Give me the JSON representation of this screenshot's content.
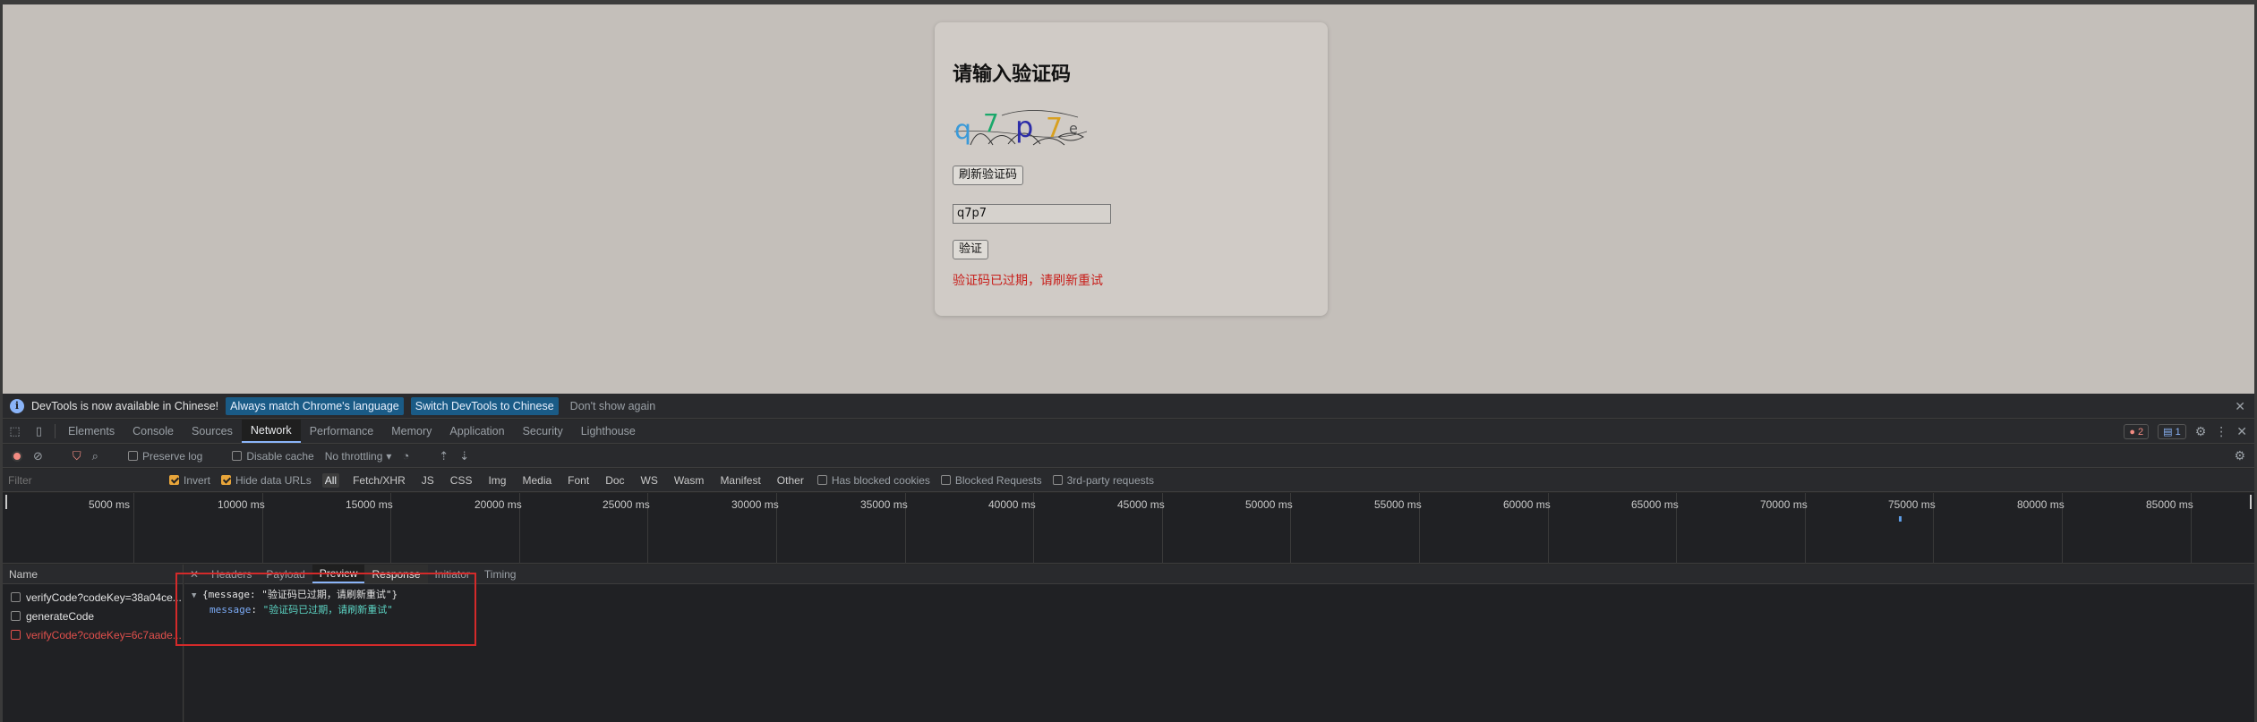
{
  "page": {
    "title": "请输入验证码",
    "refresh_button": "刷新验证码",
    "code_value": "q7p7",
    "verify_button": "验证",
    "error_message": "验证码已过期，请刷新重试",
    "captcha_chars": [
      "q",
      "7",
      "p",
      "7",
      "e"
    ]
  },
  "devtools": {
    "info": {
      "text": "DevTools is now available in Chinese!",
      "btn_match": "Always match Chrome's language",
      "btn_switch": "Switch DevTools to Chinese",
      "dismiss": "Don't show again"
    },
    "tabs": [
      "Elements",
      "Console",
      "Sources",
      "Network",
      "Performance",
      "Memory",
      "Application",
      "Security",
      "Lighthouse"
    ],
    "active_tab": "Network",
    "error_count": "2",
    "info_count": "1",
    "network": {
      "preserve_log": "Preserve log",
      "disable_cache": "Disable cache",
      "throttling": "No throttling"
    },
    "filter": {
      "placeholder": "Filter",
      "invert": "Invert",
      "hide_data_urls": "Hide data URLs",
      "types": [
        "All",
        "Fetch/XHR",
        "JS",
        "CSS",
        "Img",
        "Media",
        "Font",
        "Doc",
        "WS",
        "Wasm",
        "Manifest",
        "Other"
      ],
      "has_blocked_cookies": "Has blocked cookies",
      "blocked_requests": "Blocked Requests",
      "third_party": "3rd-party requests"
    },
    "timeline_ticks": [
      "5000 ms",
      "10000 ms",
      "15000 ms",
      "20000 ms",
      "25000 ms",
      "30000 ms",
      "35000 ms",
      "40000 ms",
      "45000 ms",
      "50000 ms",
      "55000 ms",
      "60000 ms",
      "65000 ms",
      "70000 ms",
      "75000 ms",
      "80000 ms",
      "85000 ms"
    ],
    "requests": {
      "header": "Name",
      "rows": [
        {
          "name": "verifyCode?codeKey=38a04ce..."
        },
        {
          "name": "generateCode"
        },
        {
          "name": "verifyCode?codeKey=6c7aade..."
        }
      ]
    },
    "detail_tabs": [
      "Headers",
      "Payload",
      "Preview",
      "Response",
      "Initiator",
      "Timing"
    ],
    "active_detail_tab": "Preview",
    "preview": {
      "summary": "{message: \"验证码已过期，请刷新重试\"}",
      "key": "message",
      "value": "\"验证码已过期，请刷新重试\""
    }
  }
}
